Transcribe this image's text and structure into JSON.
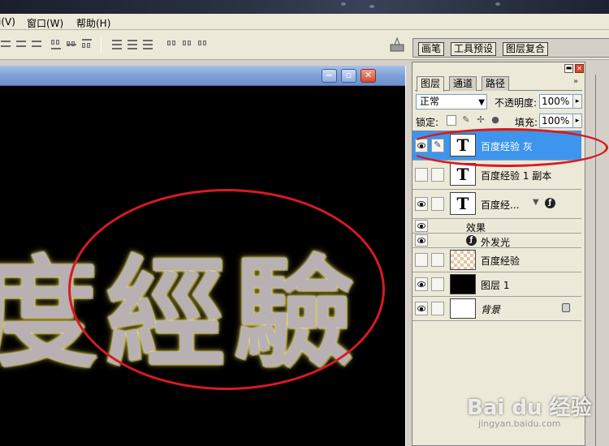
{
  "menubar": {
    "items": [
      "i(V)",
      "窗口(W)",
      "帮助(H)"
    ]
  },
  "well_tabs": [
    "画笔",
    "工具预设",
    "图层复合"
  ],
  "document": {
    "canvas_text": "度經驗",
    "buttons": [
      "minimize",
      "restore",
      "close"
    ]
  },
  "palette": {
    "tabs": [
      "图层",
      "通道",
      "路径"
    ],
    "blend_mode": "正常",
    "opacity_label": "不透明度:",
    "opacity_value": "100%",
    "lock_label": "锁定:",
    "fill_label": "填充:",
    "fill_value": "100%",
    "layers": [
      {
        "name": "百度经验 灰",
        "type": "text",
        "visible": true,
        "selected": true
      },
      {
        "name": "百度经验 1 副本",
        "type": "text",
        "visible": false,
        "selected": false
      },
      {
        "name": "百度经...",
        "type": "text",
        "visible": true,
        "selected": false,
        "has_effects": true
      },
      {
        "name": "百度经验",
        "type": "pattern",
        "visible": false,
        "selected": false
      },
      {
        "name": "图层 1",
        "type": "black",
        "visible": true,
        "selected": false
      },
      {
        "name": "背景",
        "type": "white",
        "visible": true,
        "selected": false,
        "locked": true
      }
    ],
    "effects": {
      "header": "效果",
      "items": [
        "外发光"
      ]
    }
  },
  "watermark": {
    "brand": "Bai du 经验",
    "url": "jingyan.baidu.com"
  },
  "colors": {
    "selection_blue": "#3d95ee",
    "annotation_red": "#d71a22",
    "glow_yellow": "#d8cc60",
    "text_gray": "#b8b0b2"
  }
}
